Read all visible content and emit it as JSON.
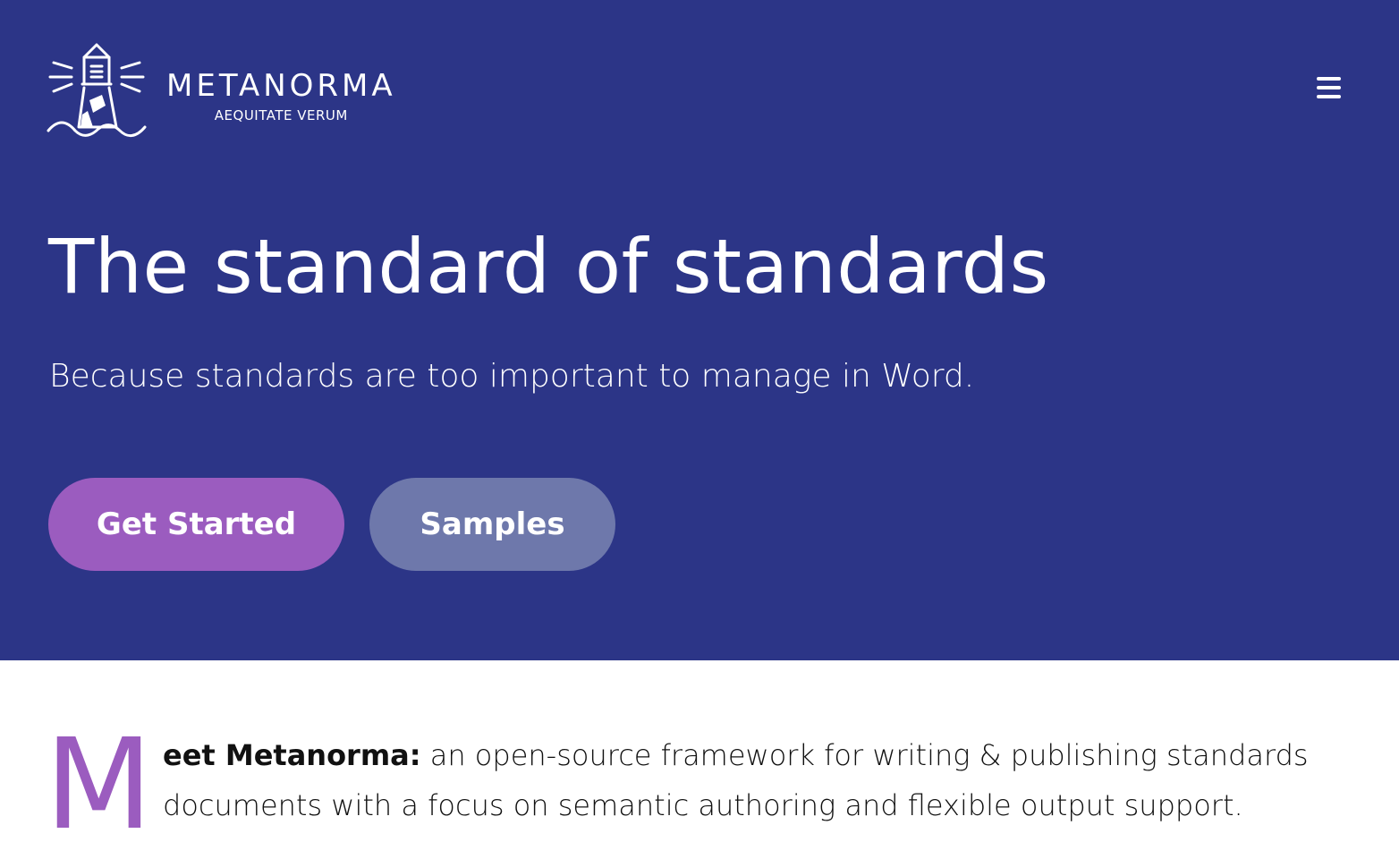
{
  "header": {
    "logo_name": "METANORMA",
    "logo_tagline": "AEQUITATE VERUM",
    "logo_icon": "lighthouse-icon",
    "menu_icon": "hamburger-menu-icon"
  },
  "hero": {
    "title": "The standard of standards",
    "subtitle": "Because standards are too important to manage in Word.",
    "primary_button": "Get Started",
    "secondary_button": "Samples"
  },
  "intro": {
    "dropcap": "M",
    "lead": "eet Metanorma:",
    "body": " an open-source framework for writing & publishing standards documents with a focus on semantic authoring and flexible output support."
  },
  "colors": {
    "hero_background": "#2c3587",
    "accent_purple": "#9b5cbf",
    "secondary_button": "#6e78ab",
    "text_dark": "#111111"
  }
}
